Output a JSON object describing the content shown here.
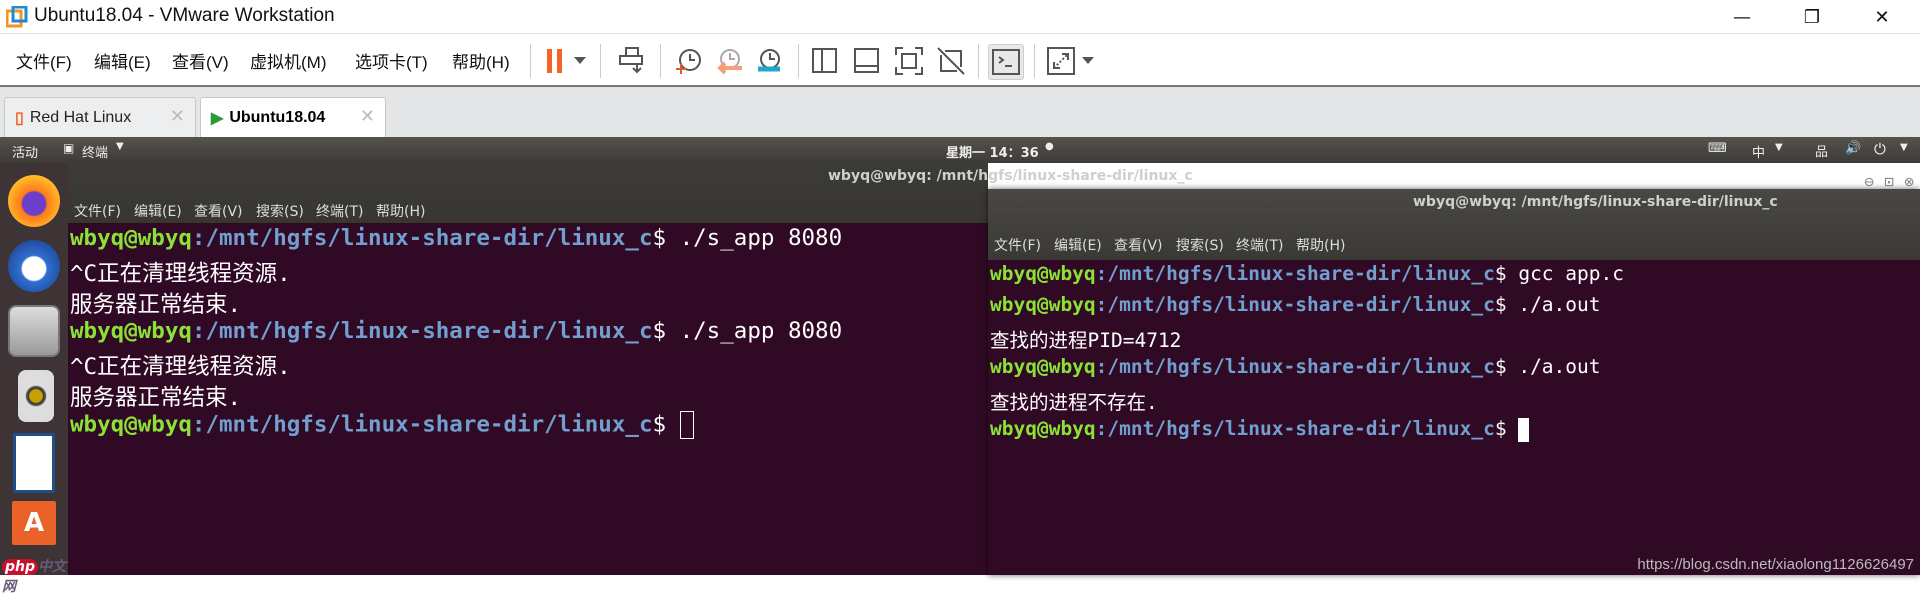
{
  "window": {
    "title": "Ubuntu18.04 - VMware Workstation"
  },
  "menu": [
    "文件(F)",
    "编辑(E)",
    "查看(V)",
    "虚拟机(M)",
    "选项卡(T)",
    "帮助(H)"
  ],
  "toolbar_icons": [
    "pause-icon",
    "send-keys-icon",
    "snapshot-take-icon",
    "snapshot-revert-icon",
    "snapshot-manager-icon",
    "view-library-icon",
    "view-thumbnail-icon",
    "fullscreen-icon",
    "unity-icon",
    "console-view-icon",
    "stretch-icon"
  ],
  "tabs": [
    {
      "label": "Red Hat Linux",
      "active": false
    },
    {
      "label": "Ubuntu18.04",
      "active": true
    }
  ],
  "ubuntu_bar": {
    "activities": "活动",
    "app": "终端",
    "clock": "星期一 14：36",
    "ime": "中"
  },
  "term1": {
    "title": "wbyq@wbyq: /mnt/hgfs/linux-share-dir/linux_c",
    "menu": [
      "文件(F)",
      "编辑(E)",
      "查看(V)",
      "搜索(S)",
      "终端(T)",
      "帮助(H)"
    ],
    "user": "wbyq@wbyq",
    "path": ":/mnt/hgfs/linux-share-dir/linux_c",
    "cmd1": "$ ./s_app 8080",
    "cmd2": "$ ./s_app 8080",
    "cmd3": "$ ",
    "out1": "^C正在清理线程资源.",
    "out2": "服务器正常结束.",
    "out3": "^C正在清理线程资源.",
    "out4": "服务器正常结束."
  },
  "term2": {
    "title": "wbyq@wbyq: /mnt/hgfs/linux-share-dir/linux_c",
    "menu": [
      "文件(F)",
      "编辑(E)",
      "查看(V)",
      "搜索(S)",
      "终端(T)",
      "帮助(H)"
    ],
    "user": "wbyq@wbyq",
    "path": ":/mnt/hgfs/linux-share-dir/linux_c",
    "cmd1": "$ gcc app.c",
    "cmd2": "$ ./a.out",
    "out1": "查找的进程PID=4712",
    "cmd3": "$ ./a.out",
    "out2": "查找的进程不存在.",
    "cmd4": "$ "
  },
  "watermark": "https://blog.csdn.net/xiaolong1126626497",
  "logo_watermark": "php中文网",
  "colors": {
    "terminal_bg": "#300a24",
    "user": "#8ae234",
    "path": "#729fcf",
    "accent": "#f26522"
  }
}
